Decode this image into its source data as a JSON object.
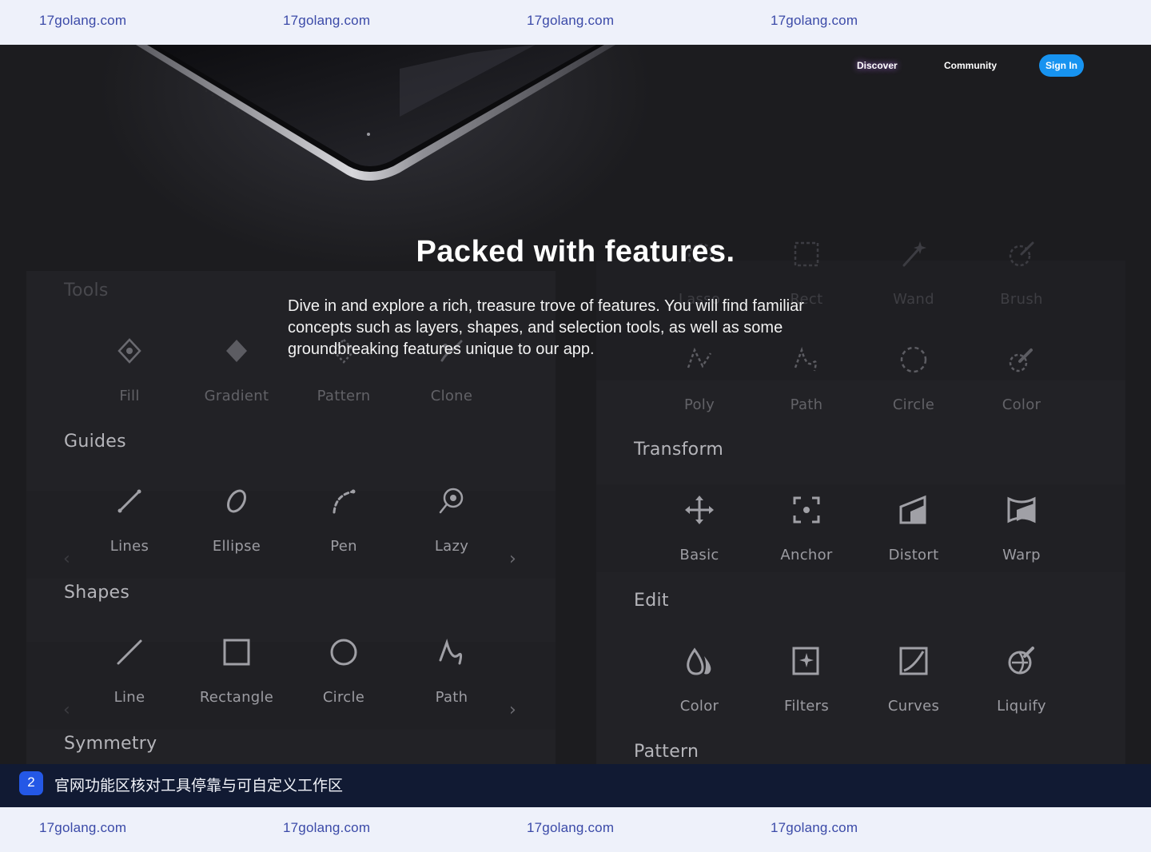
{
  "watermarks": {
    "text": "17golang.com"
  },
  "nav": {
    "discover": "Discover",
    "community": "Community",
    "sign_in": "Sign In"
  },
  "hero": {
    "headline": "Packed with features.",
    "lede": "Dive in and explore a rich, treasure trove of features. You will find familiar concepts such as layers, shapes, and selection tools, as well as some groundbreaking features unique to our app."
  },
  "left_panel": {
    "tools_title": "Tools",
    "tools": [
      "Fill",
      "Gradient",
      "Pattern",
      "Clone"
    ],
    "guides_title": "Guides",
    "guides": [
      "Lines",
      "Ellipse",
      "Pen",
      "Lazy"
    ],
    "shapes_title": "Shapes",
    "shapes": [
      "Line",
      "Rectangle",
      "Circle",
      "Path"
    ],
    "symmetry_title": "Symmetry"
  },
  "right_panel": {
    "top_faint": [
      "Lasso",
      "Rect",
      "Wand",
      "Brush"
    ],
    "select": [
      "Poly",
      "Path",
      "Circle",
      "Color"
    ],
    "transform_title": "Transform",
    "transform": [
      "Basic",
      "Anchor",
      "Distort",
      "Warp"
    ],
    "edit_title": "Edit",
    "edit": [
      "Color",
      "Filters",
      "Curves",
      "Liquify"
    ],
    "pattern_title": "Pattern"
  },
  "arrows": {
    "prev": "‹",
    "next": "›"
  },
  "caption": {
    "number": "2",
    "text": "官网功能区核对工具停靠与可自定义工作区"
  },
  "colors": {
    "background": "#1c1c1f",
    "panel": "#222226",
    "accent_button": "#1793f0",
    "caption_bg": "#111a33",
    "badge": "#2458e6",
    "watermark": "#3b4aa8"
  }
}
